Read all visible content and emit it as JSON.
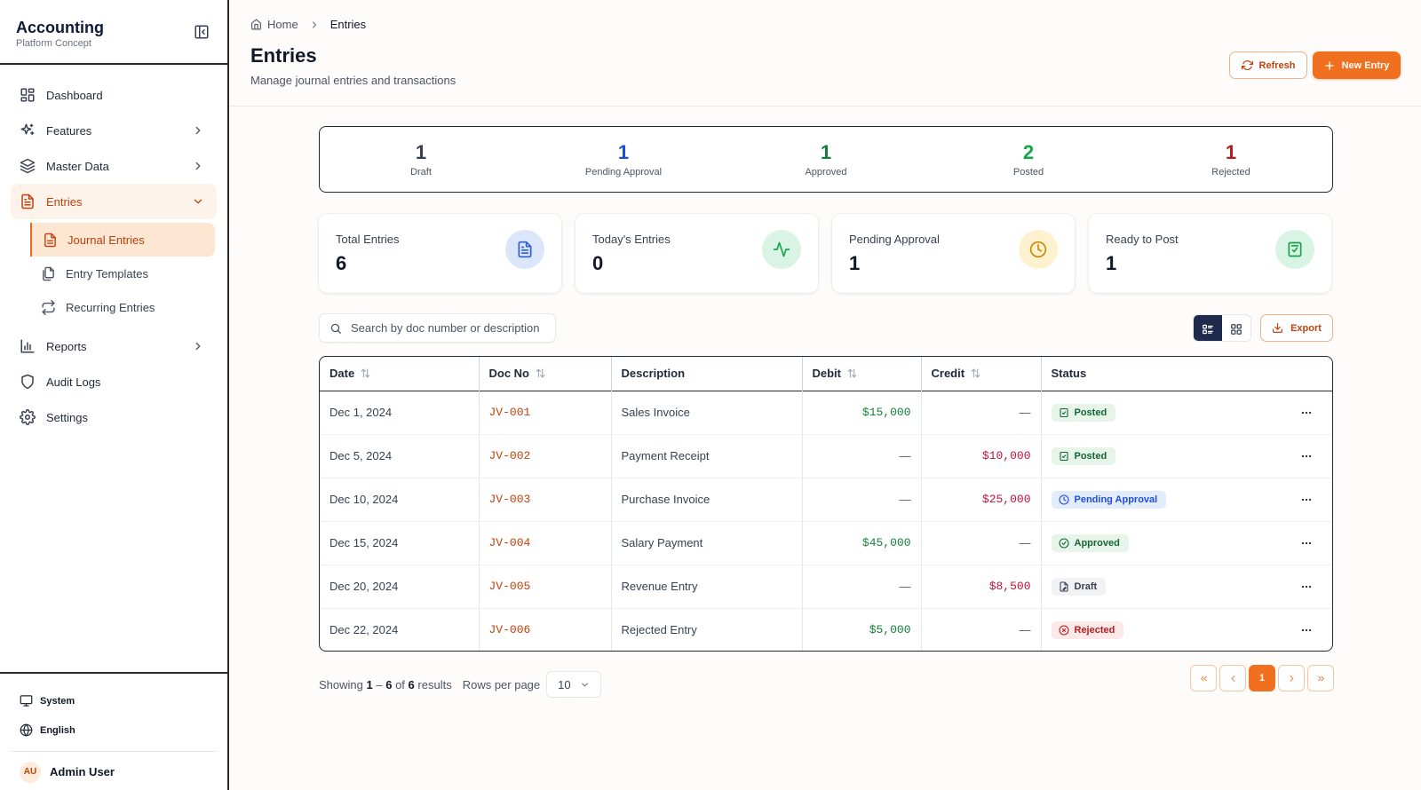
{
  "sidebar": {
    "brand_title": "Accounting",
    "brand_sub": "Platform Concept",
    "items": [
      {
        "label": "Dashboard"
      },
      {
        "label": "Features"
      },
      {
        "label": "Master Data"
      },
      {
        "label": "Entries"
      },
      {
        "label": "Reports"
      },
      {
        "label": "Audit Logs"
      },
      {
        "label": "Settings"
      }
    ],
    "sub_items": [
      {
        "label": "Journal Entries"
      },
      {
        "label": "Entry Templates"
      },
      {
        "label": "Recurring Entries"
      }
    ],
    "footer": {
      "theme": "System",
      "language": "English",
      "avatar_initials": "AU",
      "user_name": "Admin User"
    }
  },
  "header": {
    "breadcrumb_home": "Home",
    "breadcrumb_current": "Entries",
    "title": "Entries",
    "subtitle": "Manage journal entries and transactions",
    "refresh_label": "Refresh",
    "new_entry_label": "New Entry"
  },
  "status_summary": [
    {
      "count": "1",
      "label": "Draft",
      "color": "#374151"
    },
    {
      "count": "1",
      "label": "Pending Approval",
      "color": "#1d4ed8"
    },
    {
      "count": "1",
      "label": "Approved",
      "color": "#15803d"
    },
    {
      "count": "2",
      "label": "Posted",
      "color": "#16a34a"
    },
    {
      "count": "1",
      "label": "Rejected",
      "color": "#b91c1c"
    }
  ],
  "stats": [
    {
      "label": "Total Entries",
      "value": "6",
      "icon": "document-icon",
      "bg": "#dbe6fb",
      "fg": "#2f5fd0"
    },
    {
      "label": "Today's Entries",
      "value": "0",
      "icon": "activity-icon",
      "bg": "#d9f3e4",
      "fg": "#16a34a"
    },
    {
      "label": "Pending Approval",
      "value": "1",
      "icon": "clock-icon",
      "bg": "#fdf1cf",
      "fg": "#ca8a04"
    },
    {
      "label": "Ready to Post",
      "value": "1",
      "icon": "clipboard-check-icon",
      "bg": "#d9f3e4",
      "fg": "#16a34a"
    }
  ],
  "toolbar": {
    "search_placeholder": "Search by doc number or description",
    "export_label": "Export"
  },
  "table": {
    "columns": [
      "Date",
      "Doc No",
      "Description",
      "Debit",
      "Credit",
      "Status"
    ],
    "rows": [
      {
        "date": "Dec 1, 2024",
        "doc": "JV-001",
        "description": "Sales Invoice",
        "debit": "$15,000",
        "credit": "—",
        "status": "Posted"
      },
      {
        "date": "Dec 5, 2024",
        "doc": "JV-002",
        "description": "Payment Receipt",
        "debit": "—",
        "credit": "$10,000",
        "status": "Posted"
      },
      {
        "date": "Dec 10, 2024",
        "doc": "JV-003",
        "description": "Purchase Invoice",
        "debit": "—",
        "credit": "$25,000",
        "status": "Pending Approval"
      },
      {
        "date": "Dec 15, 2024",
        "doc": "JV-004",
        "description": "Salary Payment",
        "debit": "$45,000",
        "credit": "—",
        "status": "Approved"
      },
      {
        "date": "Dec 20, 2024",
        "doc": "JV-005",
        "description": "Revenue Entry",
        "debit": "—",
        "credit": "$8,500",
        "status": "Draft"
      },
      {
        "date": "Dec 22, 2024",
        "doc": "JV-006",
        "description": "Rejected Entry",
        "debit": "$5,000",
        "credit": "—",
        "status": "Rejected"
      }
    ]
  },
  "pagination": {
    "showing_prefix": "Showing",
    "range_start": "1",
    "range_sep": "–",
    "range_end": "6",
    "of_word": "of",
    "total": "6",
    "results_word": "results",
    "rows_per_page_label": "Rows per page",
    "rows_per_page_value": "10",
    "current_page": "1"
  }
}
